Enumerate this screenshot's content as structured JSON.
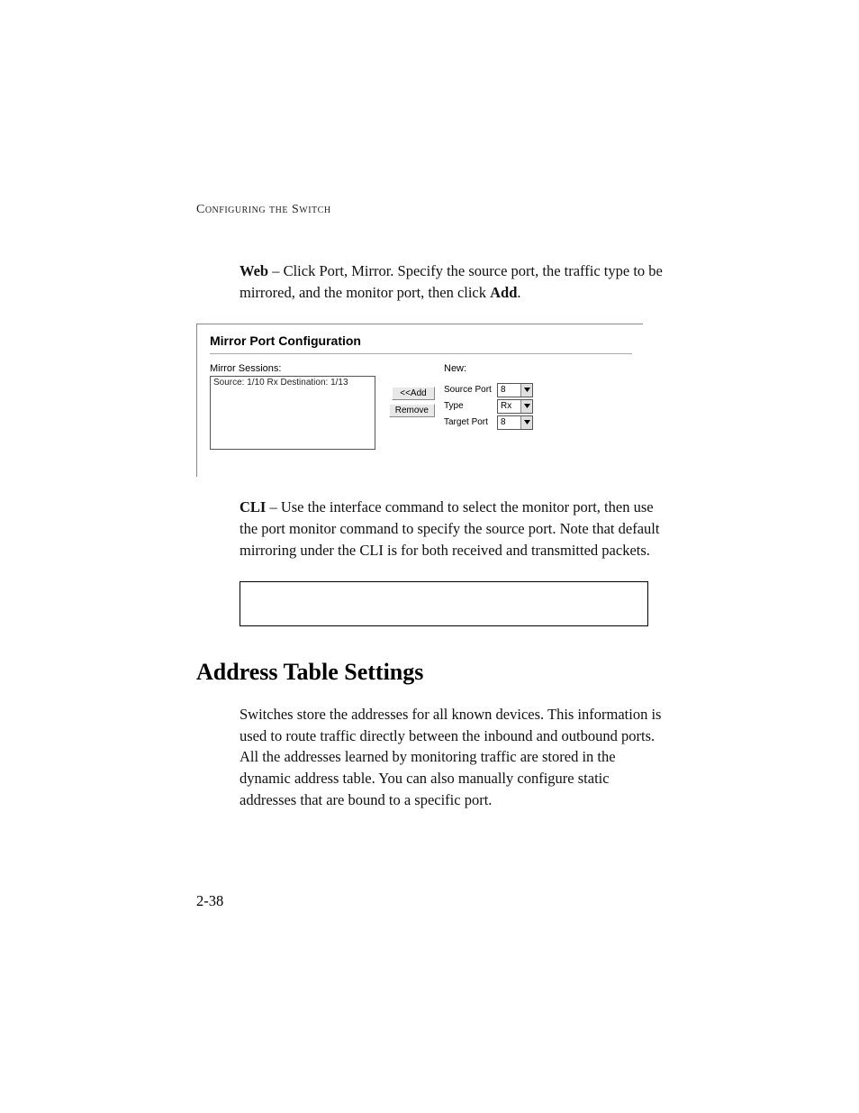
{
  "runningHead": "Configuring the Switch",
  "web": {
    "label": "Web",
    "text1": " – Click Port, Mirror. Specify the source port, the traffic type to be mirrored, and the monitor port, then click ",
    "addWord": "Add",
    "period": "."
  },
  "panel": {
    "title": "Mirror Port Configuration",
    "sessionsLabel": "Mirror Sessions:",
    "sessionsItem": "Source: 1/10 Rx Destination: 1/13",
    "newLabel": "New:",
    "addBtn": "<<Add",
    "removeBtn": "Remove",
    "sourcePortLabel": "Source Port",
    "sourcePortValue": "8",
    "typeLabel": "Type",
    "typeValue": "Rx",
    "targetPortLabel": "Target Port",
    "targetPortValue": "8"
  },
  "cli": {
    "label": "CLI",
    "text": " – Use the interface command to select the monitor port, then use the port monitor command to specify the source port. Note that default mirroring under the CLI is for both received and transmitted packets."
  },
  "sectionTitle": "Address Table Settings",
  "sectionBody": "Switches store the addresses for all known devices. This information is used to route traffic directly between the inbound and outbound ports. All the addresses learned by monitoring traffic are stored in the dynamic address table. You can also manually configure static addresses that are bound to a specific port.",
  "pageNum": "2-38"
}
